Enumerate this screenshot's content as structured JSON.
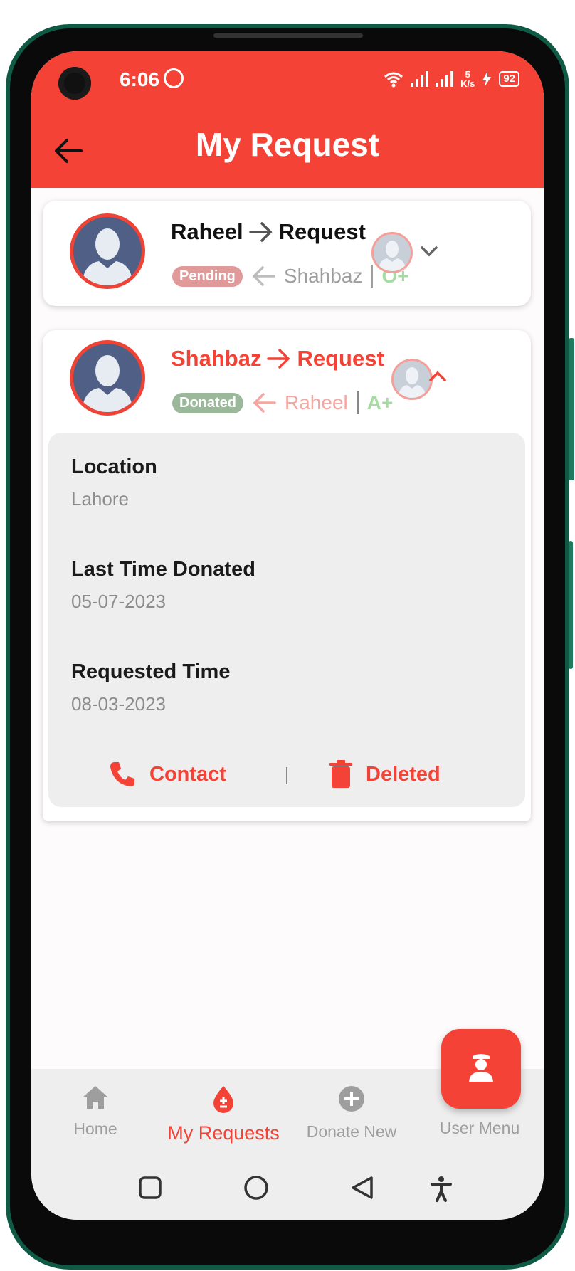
{
  "status_bar": {
    "time": "6:06",
    "network_speed_value": "5",
    "network_speed_unit": "K/s",
    "battery": "92"
  },
  "header": {
    "title": "My Request",
    "back_icon": "arrow-left-icon"
  },
  "requests": [
    {
      "donor": "Raheel",
      "label": "Request",
      "status": "Pending",
      "status_color": "#e09a9a",
      "requester": "Shahbaz",
      "blood_group": "O+",
      "expanded": false
    },
    {
      "donor": "Shahbaz",
      "label": "Request",
      "status": "Donated",
      "status_color": "#9bb89b",
      "requester": "Raheel",
      "blood_group": "A+",
      "expanded": true,
      "details": {
        "location_label": "Location",
        "location_value": "Lahore",
        "last_donated_label": "Last Time Donated",
        "last_donated_value": "05-07-2023",
        "requested_label": "Requested Time",
        "requested_value": "08-03-2023"
      },
      "actions": {
        "contact": "Contact",
        "delete": "Deleted"
      }
    }
  ],
  "fab": {
    "icon": "user-icon"
  },
  "bottom_nav": {
    "items": [
      {
        "label": "Home",
        "icon": "home-icon"
      },
      {
        "label": "My Requests",
        "icon": "blood-drop-icon",
        "active": true
      },
      {
        "label": "Donate New",
        "icon": "plus-circle-icon"
      },
      {
        "label": "User Menu",
        "icon": "user-icon"
      }
    ]
  },
  "colors": {
    "primary": "#f44336",
    "text_dark": "#1a1a1a",
    "muted": "#8c8c8c",
    "green": "#9ed49a"
  }
}
